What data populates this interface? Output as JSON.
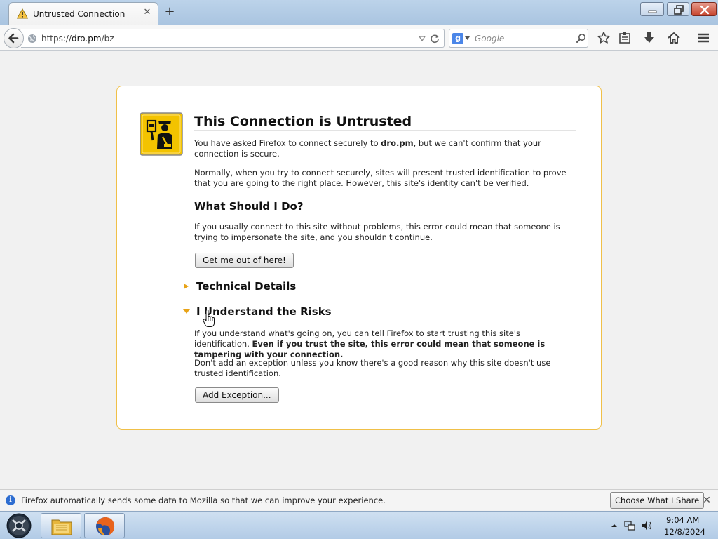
{
  "browser": {
    "tab": {
      "title": "Untrusted Connection"
    },
    "address": {
      "protocol": "https://",
      "host": "dro.pm",
      "path": "/bz"
    },
    "search": {
      "placeholder": "Google"
    }
  },
  "error_page": {
    "title": "This Connection is Untrusted",
    "intro_before": "You have asked Firefox to connect securely to ",
    "intro_host": "dro.pm",
    "intro_after": ", but we can't confirm that your connection is secure.",
    "normal_text": "Normally, when you try to connect securely, sites will present trusted identification to prove that you are going to the right place. However, this site's identity can't be verified.",
    "what_heading": "What Should I Do?",
    "what_text": "If you usually connect to this site without problems, this error could mean that someone is trying to impersonate the site, and you shouldn't continue.",
    "get_out_label": "Get me out of here!",
    "technical_heading": "Technical Details",
    "risks_heading": "I Understand the Risks",
    "risks_text": "If you understand what's going on, you can tell Firefox to start trusting this site's identification. ",
    "risks_text_bold": "Even if you trust the site, this error could mean that someone is tampering with your connection.",
    "exception_note": "Don't add an exception unless you know there's a good reason why this site doesn't use trusted identification.",
    "add_exception_label": "Add Exception..."
  },
  "notification": {
    "text": "Firefox automatically sends some data to Mozilla so that we can improve your experience.",
    "button_label": "Choose What I Share"
  },
  "taskbar": {
    "clock_time": "9:04 AM",
    "clock_date": "12/8/2024"
  },
  "icons": {
    "tab": "warning-icon",
    "nav": [
      "back-arrow-icon",
      "globe-icon",
      "reload-icon",
      "magnifier-icon",
      "star-icon",
      "reading-list-icon",
      "download-icon",
      "home-icon",
      "menu-icon"
    ],
    "page": "security-officer-icon",
    "notification": "info-icon"
  },
  "colors": {
    "error_border": "#f0c048",
    "expander_arrow": "#e8a317",
    "info_blue": "#2f6ed1",
    "close_red": "#c8452e"
  }
}
